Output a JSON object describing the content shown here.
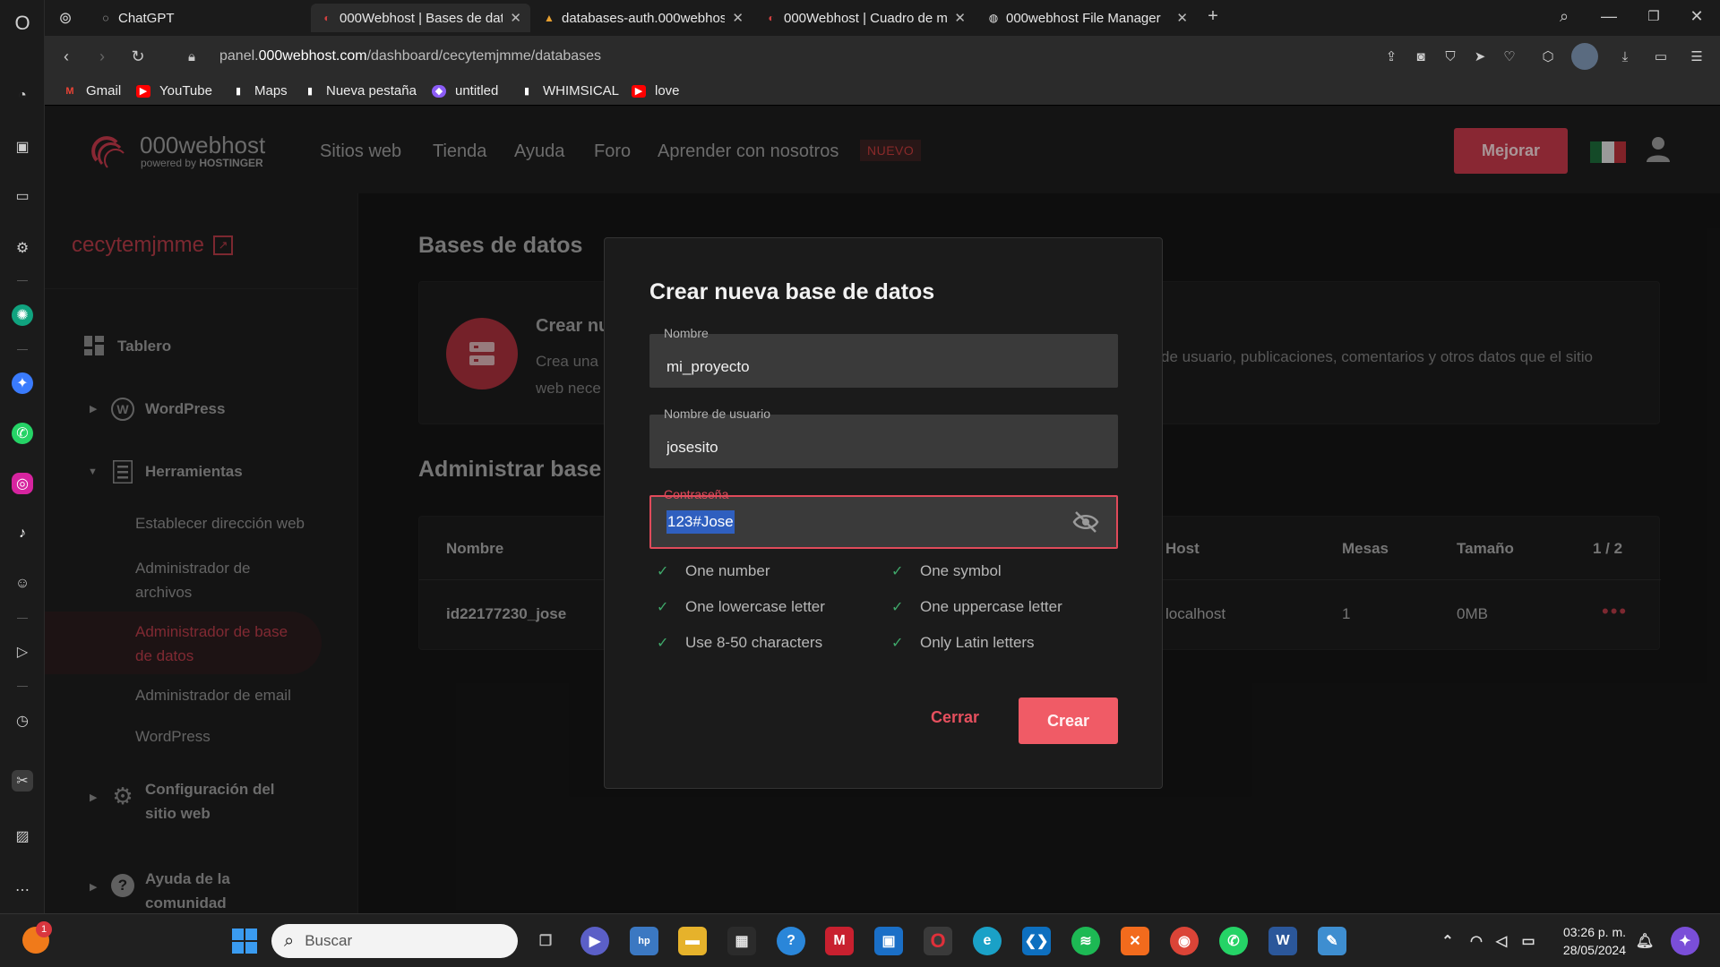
{
  "browser": {
    "tabs": [
      {
        "title": "ChatGPT",
        "active": false
      },
      {
        "title": "000Webhost | Bases de dat",
        "active": true
      },
      {
        "title": "databases-auth.000webhos",
        "active": false
      },
      {
        "title": "000Webhost | Cuadro de m",
        "active": false
      },
      {
        "title": "000webhost File Manager",
        "active": false
      }
    ],
    "url_prefix": "panel.",
    "url_domain": "000webhost.com",
    "url_path": "/dashboard/cecytemjmme/databases",
    "bookmarks": [
      "Gmail",
      "YouTube",
      "Maps",
      "Nueva pestaña",
      "untitled",
      "WHIMSICAL",
      "love"
    ]
  },
  "site": {
    "logo_main": "000webhost",
    "logo_sub_prefix": "powered by ",
    "logo_sub_brand": "HOSTINGER",
    "nav": [
      "Sitios web",
      "Tienda",
      "Ayuda",
      "Foro",
      "Aprender con nosotros"
    ],
    "badge_new": "NUEVO",
    "upgrade_label": "Mejorar"
  },
  "sidebar": {
    "site_name": "cecytemjmme",
    "items": {
      "tablero": "Tablero",
      "wordpress": "WordPress",
      "herramientas": "Herramientas",
      "sub_direccion": "Establecer dirección web",
      "sub_archivos_1": "Administrador de",
      "sub_archivos_2": "archivos",
      "sub_bd_1": "Administrador de base",
      "sub_bd_2": "de datos",
      "sub_email": "Administrador de email",
      "sub_wordpress": "WordPress",
      "config_1": "Configuración del",
      "config_2": "sitio web",
      "ayuda_1": "Ayuda de la",
      "ayuda_2": "comunidad"
    }
  },
  "main": {
    "page_title": "Bases de datos",
    "create_card_title": "Crear nu",
    "create_card_text_1": "Crea una",
    "create_card_text_2": "web nece",
    "create_card_text_right": "de usuario, publicaciones, comentarios y otros datos que el sitio",
    "manage_title": "Administrar base",
    "table_headers": {
      "name": "Nombre",
      "host": "Host",
      "tables": "Mesas",
      "size": "Tamaño",
      "page": "1 / 2"
    },
    "row": {
      "name": "id22177230_jose",
      "host": "localhost",
      "tables": "1",
      "size": "0MB"
    }
  },
  "modal": {
    "title": "Crear nueva base de datos",
    "name_label": "Nombre",
    "name_value": "mi_proyecto",
    "user_label": "Nombre de usuario",
    "user_value": "josesito",
    "pass_label": "Contraseña",
    "pass_value": "123#Jose",
    "rules": [
      "One number",
      "One symbol",
      "One lowercase letter",
      "One uppercase letter",
      "Use 8-50 characters",
      "Only Latin letters"
    ],
    "close_label": "Cerrar",
    "create_label": "Crear"
  },
  "taskbar": {
    "search_placeholder": "Buscar",
    "time": "03:26 p. m.",
    "date": "28/05/2024",
    "notification_count": "1"
  },
  "colors": {
    "accent": "#c4394a",
    "create_button": "#f05b66",
    "check": "#3fa86a",
    "site_name": "#d64553"
  }
}
